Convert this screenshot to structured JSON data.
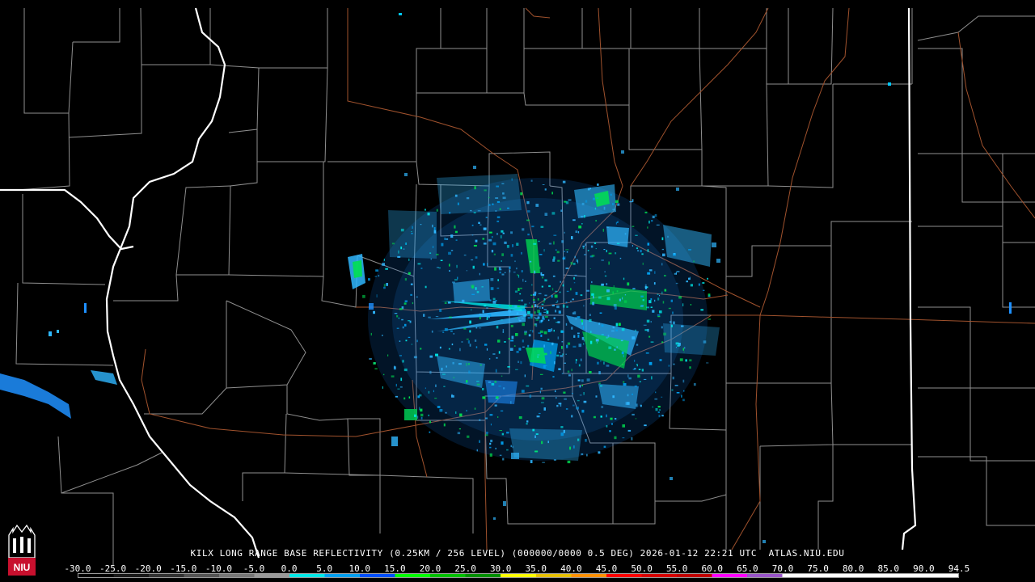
{
  "caption": "KILX LONG RANGE BASE REFLECTIVITY (0.25KM / 256 LEVEL) (000000/0000 0.5 DEG) 2026-01-12 22:21 UTC  ATLAS.NIU.EDU",
  "scale": {
    "labels": [
      "-30.0",
      "-25.0",
      "-20.0",
      "-15.0",
      "-10.0",
      "-5.0",
      "0.0",
      "5.0",
      "10.0",
      "15.0",
      "20.0",
      "25.0",
      "30.0",
      "35.0",
      "40.0",
      "45.0",
      "50.0",
      "55.0",
      "60.0",
      "65.0",
      "70.0",
      "75.0",
      "80.0",
      "85.0",
      "90.0",
      "94.5"
    ],
    "colors": [
      "#000000",
      "#1a1a1a",
      "#333333",
      "#555555",
      "#777777",
      "#999999",
      "#00e8e8",
      "#00a0f0",
      "#0050ff",
      "#00ff00",
      "#00c000",
      "#009000",
      "#ffff00",
      "#e7c000",
      "#ff9000",
      "#ff0000",
      "#d60000",
      "#c00000",
      "#ff00ff",
      "#9955c9",
      "#ffffff",
      "#ffffff",
      "#ffffff",
      "#ffffff",
      "#ffffff"
    ]
  },
  "logo": {
    "text": "NIU"
  },
  "colors": {
    "background": "#000000",
    "county_lines": "#9a9a9a",
    "state_lines": "#ffffff",
    "highways": "#a0522d",
    "echo_light": "#2fb7ff",
    "echo_medium": "#00e050",
    "echo_strong": "#00a040"
  }
}
